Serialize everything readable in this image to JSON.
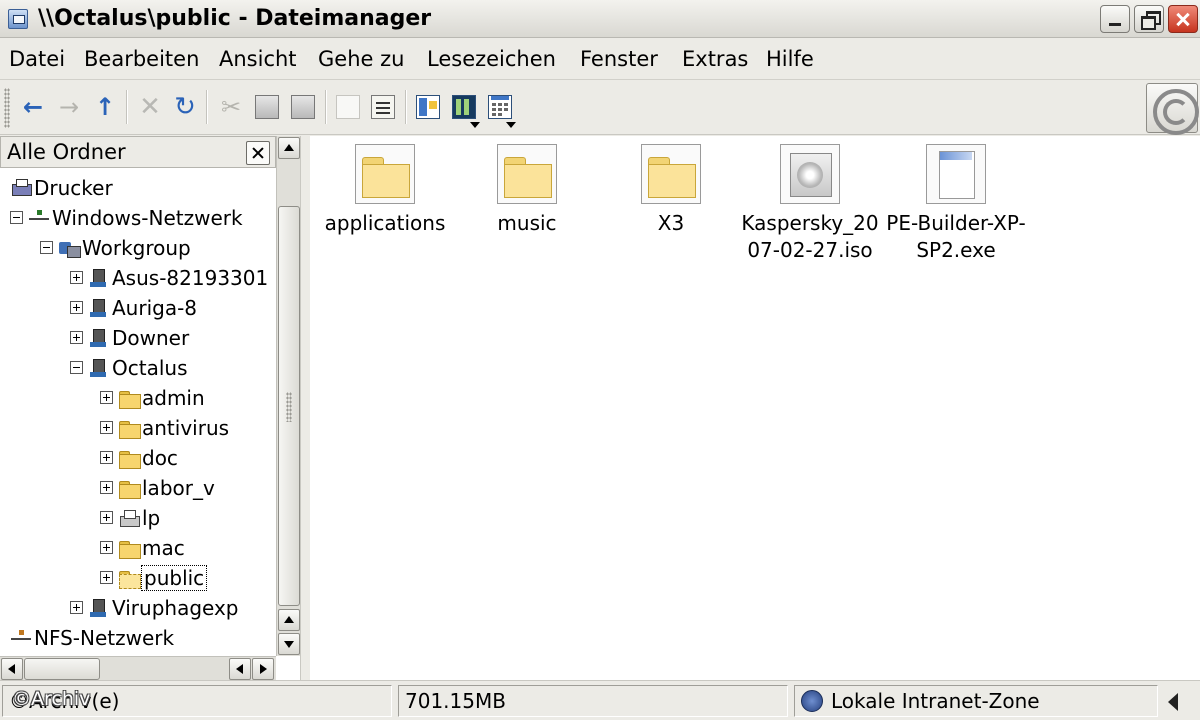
{
  "window": {
    "title": "\\\\Octalus\\public - Dateimanager"
  },
  "menu": [
    "Datei",
    "Bearbeiten",
    "Ansicht",
    "Gehe zu",
    "Lesezeichen",
    "Fenster",
    "Extras",
    "Hilfe"
  ],
  "toolbar": {
    "icons": [
      "back-icon",
      "forward-icon",
      "up-icon",
      "stop-icon",
      "reload-icon",
      "cut-icon",
      "copy-icon",
      "paste-icon",
      "delete-icon",
      "properties-icon",
      "tree-view-icon",
      "column-view-icon",
      "icon-view-icon",
      "throbber-icon"
    ],
    "back": "←",
    "forward": "→",
    "up": "↑",
    "stop": "✕",
    "reload": "↻",
    "cut": "✂"
  },
  "folder_pane": {
    "title": "Alle Ordner",
    "tree": [
      {
        "label": "Drucker",
        "icon": "printer-icon"
      },
      {
        "label": "Windows-Netzwerk",
        "icon": "network-icon",
        "expanded": true
      },
      {
        "label": "Workgroup",
        "icon": "workgroup-icon",
        "expanded": true
      },
      {
        "label": "Asus-82193301",
        "icon": "computer-icon",
        "expanded": false
      },
      {
        "label": "Auriga-8",
        "icon": "computer-icon",
        "expanded": false
      },
      {
        "label": "Downer",
        "icon": "computer-icon",
        "expanded": false
      },
      {
        "label": "Octalus",
        "icon": "computer-icon",
        "expanded": true
      },
      {
        "label": "admin",
        "icon": "folder-icon",
        "expanded": false
      },
      {
        "label": "antivirus",
        "icon": "folder-icon",
        "expanded": false
      },
      {
        "label": "doc",
        "icon": "folder-icon",
        "expanded": false
      },
      {
        "label": "labor_v",
        "icon": "folder-icon",
        "expanded": false
      },
      {
        "label": "lp",
        "icon": "printer-share-icon",
        "expanded": false
      },
      {
        "label": "mac",
        "icon": "folder-icon",
        "expanded": false
      },
      {
        "label": "public",
        "icon": "folder-open-icon",
        "expanded": false,
        "selected": true
      },
      {
        "label": "Viruphagexp",
        "icon": "computer-icon",
        "expanded": false
      },
      {
        "label": "NFS-Netzwerk",
        "icon": "network-icon"
      }
    ]
  },
  "files": [
    {
      "name": "applications",
      "type": "folder"
    },
    {
      "name": "music",
      "type": "folder"
    },
    {
      "name": "X3",
      "type": "folder"
    },
    {
      "name": "Kaspersky_2007-02-27.iso",
      "type": "iso"
    },
    {
      "name": "PE-Builder-XP-SP2.exe",
      "type": "exe"
    }
  ],
  "status": {
    "left": "©Archiv(e)",
    "size": "701.15MB",
    "zone": "Lokale Intranet-Zone"
  },
  "watermark": "©Archiv"
}
